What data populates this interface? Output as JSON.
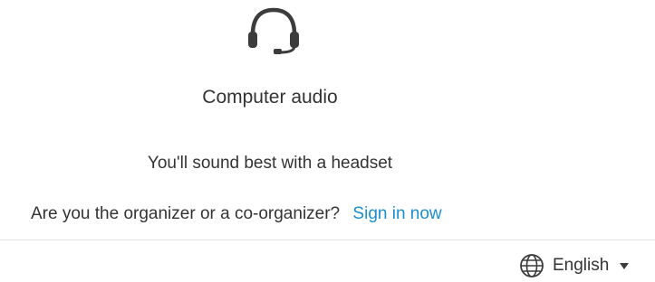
{
  "audio": {
    "icon": "headset-icon",
    "title": "Computer audio",
    "hint": "You'll sound best with a headset"
  },
  "organizer": {
    "question": "Are you the organizer or a co-organizer?",
    "sign_in_label": "Sign in now"
  },
  "language": {
    "icon": "globe-icon",
    "selected": "English",
    "dropdown_icon": "caret-down-icon"
  },
  "colors": {
    "link": "#1b8ecf",
    "text": "#333333",
    "icon": "#3c3c3c",
    "divider": "#e4e4e4"
  }
}
